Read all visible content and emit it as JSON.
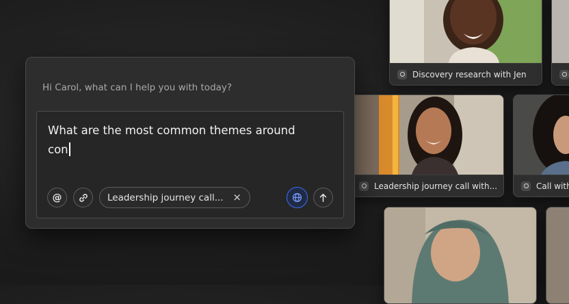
{
  "chat": {
    "greeting": "Hi Carol, what can I help you with today?",
    "query_line1": "What are the most common themes around",
    "query_line2": "con",
    "attachment_chip": "Leadership journey call...",
    "remove_icon": "×",
    "buttons": {
      "mention": "@",
      "attach": "link-icon",
      "web_search": "globe-icon",
      "send": "arrow-up-icon"
    },
    "accent_color": "#3b6ff5"
  },
  "recordings": [
    {
      "caption": "Discovery research with Jen"
    },
    {
      "caption": "Leadership journey call with..."
    },
    {
      "caption": "Call with"
    }
  ]
}
